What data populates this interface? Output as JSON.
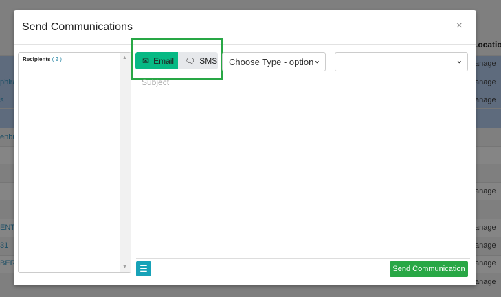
{
  "background": {
    "header": "Location",
    "left_fragments": [
      "phira",
      "s",
      "enbu",
      "ENT",
      "31",
      "BER"
    ],
    "action_fragment": "anage"
  },
  "modal": {
    "title": "Send Communications",
    "close": "×",
    "recipients": {
      "label": "Recipients",
      "count": "( 2 )"
    },
    "channels": [
      {
        "label": "Email",
        "icon": "envelope-icon",
        "active": true
      },
      {
        "label": "SMS",
        "icon": "chat-icon",
        "active": false
      }
    ],
    "type_select": {
      "value": "Choose Type - option"
    },
    "second_select": {
      "value": ""
    },
    "subject": {
      "placeholder": "Subject"
    },
    "menu_icon": "hamburger-icon",
    "send_label": "Send Communication",
    "colors": {
      "email_active": "#06b984",
      "send": "#28a745",
      "menu": "#17a2b8",
      "highlight": "#28a745"
    }
  }
}
